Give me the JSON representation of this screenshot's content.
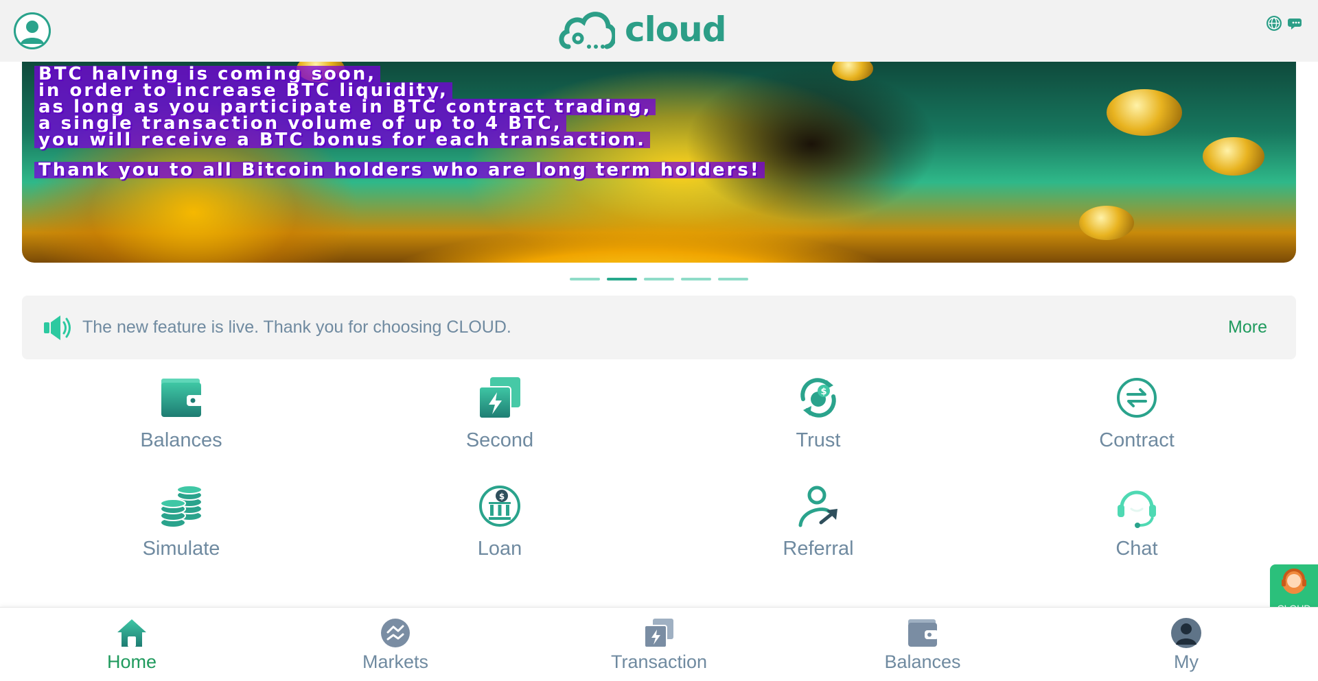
{
  "header": {
    "logo_text": "cloud",
    "avatar_icon": "user-avatar-icon",
    "right_icons": [
      "globe-icon",
      "chat-bubble-icon"
    ]
  },
  "banner": {
    "lines": [
      "BTC halving is coming soon,",
      " in order to increase BTC liquidity,",
      "as long as you participate in BTC contract trading,",
      "a single transaction volume of up to 4 BTC,",
      "you will receive a BTC bonus for each transaction.",
      "Thank you to all Bitcoin holders who are long term holders!"
    ]
  },
  "carousel": {
    "count": 5,
    "active_index": 1
  },
  "notice": {
    "icon": "speaker-icon",
    "text": "The new feature is live. Thank you for choosing CLOUD.",
    "more_label": "More"
  },
  "features": [
    {
      "label": "Balances",
      "icon": "wallet-icon"
    },
    {
      "label": "Second",
      "icon": "lightning-card-icon"
    },
    {
      "label": "Trust",
      "icon": "dollar-refresh-icon"
    },
    {
      "label": "Contract",
      "icon": "exchange-arrows-icon"
    },
    {
      "label": "Simulate",
      "icon": "coin-stack-icon"
    },
    {
      "label": "Loan",
      "icon": "bank-dollar-icon"
    },
    {
      "label": "Referral",
      "icon": "user-arrow-icon"
    },
    {
      "label": "Chat",
      "icon": "headset-icon"
    }
  ],
  "float_chat": {
    "label": "CLOUD",
    "icon": "support-agent-icon"
  },
  "bottom_nav": {
    "active": "Home",
    "items": [
      {
        "label": "Home",
        "icon": "home-icon"
      },
      {
        "label": "Markets",
        "icon": "markets-icon"
      },
      {
        "label": "Transaction",
        "icon": "transaction-icon"
      },
      {
        "label": "Balances",
        "icon": "wallet-icon"
      },
      {
        "label": "My",
        "icon": "profile-icon"
      }
    ]
  },
  "colors": {
    "accent": "#2c9e87",
    "accent_dark": "#1f9a5d",
    "muted_text": "#6f8aa0",
    "header_bg": "#f2f2f2",
    "notice_bg": "#f3f3f3"
  }
}
